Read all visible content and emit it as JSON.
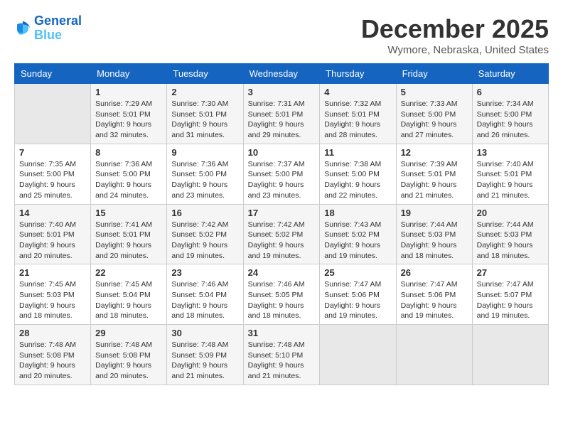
{
  "header": {
    "logo_line1": "General",
    "logo_line2": "Blue",
    "title": "December 2025",
    "subtitle": "Wymore, Nebraska, United States"
  },
  "weekdays": [
    "Sunday",
    "Monday",
    "Tuesday",
    "Wednesday",
    "Thursday",
    "Friday",
    "Saturday"
  ],
  "weeks": [
    [
      {
        "day": "",
        "sunrise": "",
        "sunset": "",
        "daylight": ""
      },
      {
        "day": "1",
        "sunrise": "Sunrise: 7:29 AM",
        "sunset": "Sunset: 5:01 PM",
        "daylight": "Daylight: 9 hours and 32 minutes."
      },
      {
        "day": "2",
        "sunrise": "Sunrise: 7:30 AM",
        "sunset": "Sunset: 5:01 PM",
        "daylight": "Daylight: 9 hours and 31 minutes."
      },
      {
        "day": "3",
        "sunrise": "Sunrise: 7:31 AM",
        "sunset": "Sunset: 5:01 PM",
        "daylight": "Daylight: 9 hours and 29 minutes."
      },
      {
        "day": "4",
        "sunrise": "Sunrise: 7:32 AM",
        "sunset": "Sunset: 5:01 PM",
        "daylight": "Daylight: 9 hours and 28 minutes."
      },
      {
        "day": "5",
        "sunrise": "Sunrise: 7:33 AM",
        "sunset": "Sunset: 5:00 PM",
        "daylight": "Daylight: 9 hours and 27 minutes."
      },
      {
        "day": "6",
        "sunrise": "Sunrise: 7:34 AM",
        "sunset": "Sunset: 5:00 PM",
        "daylight": "Daylight: 9 hours and 26 minutes."
      }
    ],
    [
      {
        "day": "7",
        "sunrise": "Sunrise: 7:35 AM",
        "sunset": "Sunset: 5:00 PM",
        "daylight": "Daylight: 9 hours and 25 minutes."
      },
      {
        "day": "8",
        "sunrise": "Sunrise: 7:36 AM",
        "sunset": "Sunset: 5:00 PM",
        "daylight": "Daylight: 9 hours and 24 minutes."
      },
      {
        "day": "9",
        "sunrise": "Sunrise: 7:36 AM",
        "sunset": "Sunset: 5:00 PM",
        "daylight": "Daylight: 9 hours and 23 minutes."
      },
      {
        "day": "10",
        "sunrise": "Sunrise: 7:37 AM",
        "sunset": "Sunset: 5:00 PM",
        "daylight": "Daylight: 9 hours and 23 minutes."
      },
      {
        "day": "11",
        "sunrise": "Sunrise: 7:38 AM",
        "sunset": "Sunset: 5:00 PM",
        "daylight": "Daylight: 9 hours and 22 minutes."
      },
      {
        "day": "12",
        "sunrise": "Sunrise: 7:39 AM",
        "sunset": "Sunset: 5:01 PM",
        "daylight": "Daylight: 9 hours and 21 minutes."
      },
      {
        "day": "13",
        "sunrise": "Sunrise: 7:40 AM",
        "sunset": "Sunset: 5:01 PM",
        "daylight": "Daylight: 9 hours and 21 minutes."
      }
    ],
    [
      {
        "day": "14",
        "sunrise": "Sunrise: 7:40 AM",
        "sunset": "Sunset: 5:01 PM",
        "daylight": "Daylight: 9 hours and 20 minutes."
      },
      {
        "day": "15",
        "sunrise": "Sunrise: 7:41 AM",
        "sunset": "Sunset: 5:01 PM",
        "daylight": "Daylight: 9 hours and 20 minutes."
      },
      {
        "day": "16",
        "sunrise": "Sunrise: 7:42 AM",
        "sunset": "Sunset: 5:02 PM",
        "daylight": "Daylight: 9 hours and 19 minutes."
      },
      {
        "day": "17",
        "sunrise": "Sunrise: 7:42 AM",
        "sunset": "Sunset: 5:02 PM",
        "daylight": "Daylight: 9 hours and 19 minutes."
      },
      {
        "day": "18",
        "sunrise": "Sunrise: 7:43 AM",
        "sunset": "Sunset: 5:02 PM",
        "daylight": "Daylight: 9 hours and 19 minutes."
      },
      {
        "day": "19",
        "sunrise": "Sunrise: 7:44 AM",
        "sunset": "Sunset: 5:03 PM",
        "daylight": "Daylight: 9 hours and 18 minutes."
      },
      {
        "day": "20",
        "sunrise": "Sunrise: 7:44 AM",
        "sunset": "Sunset: 5:03 PM",
        "daylight": "Daylight: 9 hours and 18 minutes."
      }
    ],
    [
      {
        "day": "21",
        "sunrise": "Sunrise: 7:45 AM",
        "sunset": "Sunset: 5:03 PM",
        "daylight": "Daylight: 9 hours and 18 minutes."
      },
      {
        "day": "22",
        "sunrise": "Sunrise: 7:45 AM",
        "sunset": "Sunset: 5:04 PM",
        "daylight": "Daylight: 9 hours and 18 minutes."
      },
      {
        "day": "23",
        "sunrise": "Sunrise: 7:46 AM",
        "sunset": "Sunset: 5:04 PM",
        "daylight": "Daylight: 9 hours and 18 minutes."
      },
      {
        "day": "24",
        "sunrise": "Sunrise: 7:46 AM",
        "sunset": "Sunset: 5:05 PM",
        "daylight": "Daylight: 9 hours and 18 minutes."
      },
      {
        "day": "25",
        "sunrise": "Sunrise: 7:47 AM",
        "sunset": "Sunset: 5:06 PM",
        "daylight": "Daylight: 9 hours and 19 minutes."
      },
      {
        "day": "26",
        "sunrise": "Sunrise: 7:47 AM",
        "sunset": "Sunset: 5:06 PM",
        "daylight": "Daylight: 9 hours and 19 minutes."
      },
      {
        "day": "27",
        "sunrise": "Sunrise: 7:47 AM",
        "sunset": "Sunset: 5:07 PM",
        "daylight": "Daylight: 9 hours and 19 minutes."
      }
    ],
    [
      {
        "day": "28",
        "sunrise": "Sunrise: 7:48 AM",
        "sunset": "Sunset: 5:08 PM",
        "daylight": "Daylight: 9 hours and 20 minutes."
      },
      {
        "day": "29",
        "sunrise": "Sunrise: 7:48 AM",
        "sunset": "Sunset: 5:08 PM",
        "daylight": "Daylight: 9 hours and 20 minutes."
      },
      {
        "day": "30",
        "sunrise": "Sunrise: 7:48 AM",
        "sunset": "Sunset: 5:09 PM",
        "daylight": "Daylight: 9 hours and 21 minutes."
      },
      {
        "day": "31",
        "sunrise": "Sunrise: 7:48 AM",
        "sunset": "Sunset: 5:10 PM",
        "daylight": "Daylight: 9 hours and 21 minutes."
      },
      {
        "day": "",
        "sunrise": "",
        "sunset": "",
        "daylight": ""
      },
      {
        "day": "",
        "sunrise": "",
        "sunset": "",
        "daylight": ""
      },
      {
        "day": "",
        "sunrise": "",
        "sunset": "",
        "daylight": ""
      }
    ]
  ]
}
